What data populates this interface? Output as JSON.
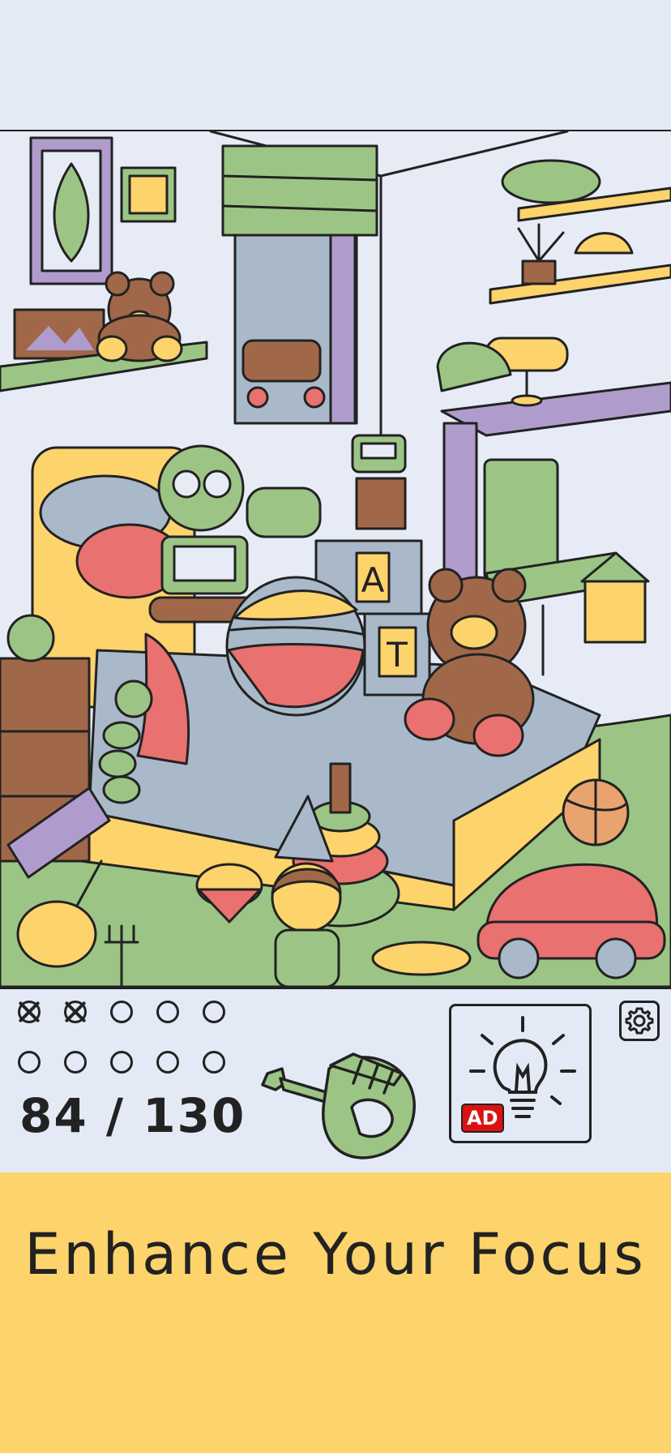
{
  "game": {
    "progress_found": 84,
    "progress_total": 130,
    "progress_text": "84 / 130",
    "ticks": [
      {
        "found": true
      },
      {
        "found": true
      },
      {
        "found": false
      },
      {
        "found": false
      },
      {
        "found": false
      },
      {
        "found": false
      },
      {
        "found": false
      },
      {
        "found": false
      },
      {
        "found": false
      },
      {
        "found": false
      }
    ],
    "target_item_icon": "watering-can-icon",
    "hint": {
      "icon": "lightbulb-icon",
      "badge": "AD"
    },
    "settings_icon": "gear-icon"
  },
  "banner": {
    "tagline": "Enhance Your Focus"
  },
  "colors": {
    "background": "#e4eaf5",
    "banner": "#fdd36c",
    "green": "#9cc585",
    "yellow": "#fdd36c",
    "pink": "#e9716f",
    "blue_grey": "#a9b9c9",
    "brown": "#a06849",
    "purple": "#b09ccc",
    "ad_red": "#dd1111"
  }
}
